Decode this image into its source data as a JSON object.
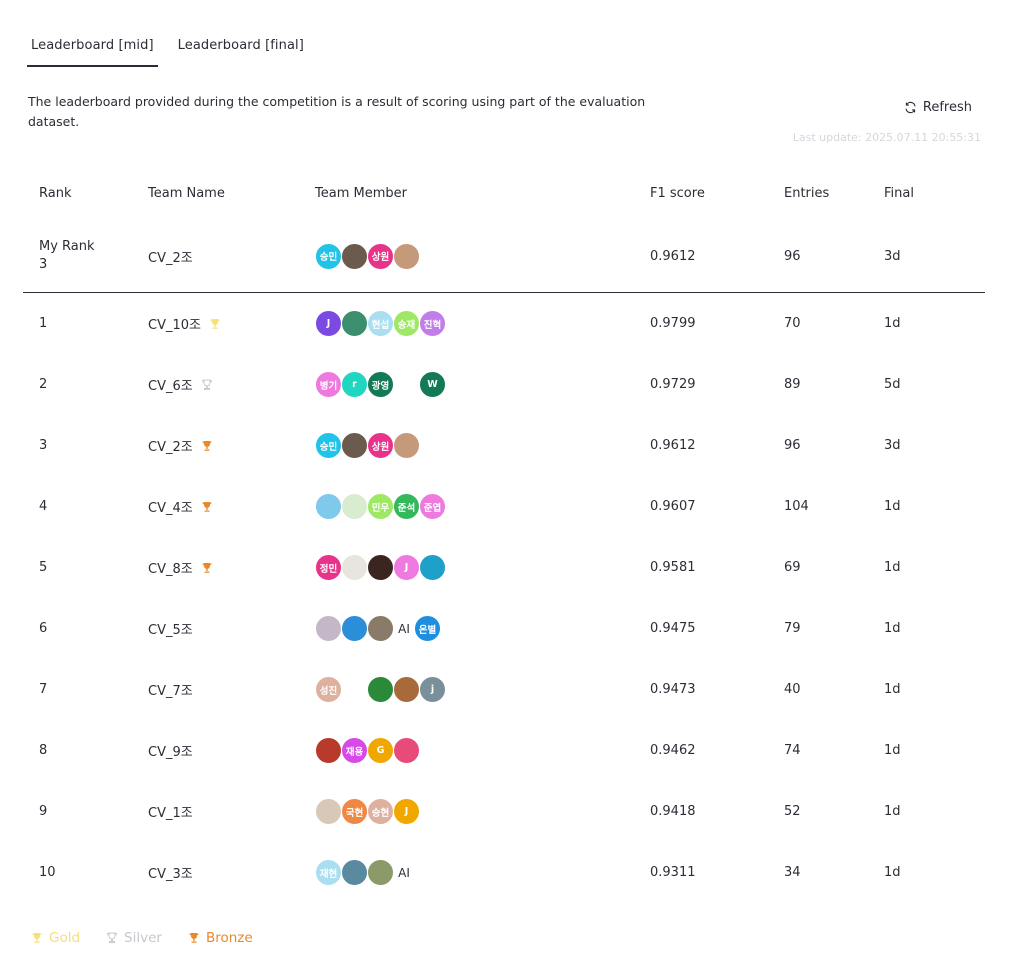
{
  "tabs": [
    {
      "label": "Leaderboard [mid]",
      "active": true
    },
    {
      "label": "Leaderboard [final]",
      "active": false
    }
  ],
  "description": "The leaderboard provided during the competition is a result of scoring using part of the evaluation dataset.",
  "refresh_label": "Refresh",
  "last_update": "Last update: 2025.07.11 20:55:31",
  "columns": {
    "rank": "Rank",
    "team": "Team Name",
    "member": "Team Member",
    "f1": "F1 score",
    "entries": "Entries",
    "final": "Final"
  },
  "my_rank": {
    "label": "My Rank",
    "rank": "3",
    "team": "CV_2조",
    "members": [
      {
        "text": "승민",
        "color": "#22c3e8"
      },
      {
        "text": "",
        "color": "#6b5a4e"
      },
      {
        "text": "상원",
        "color": "#e8338a"
      },
      {
        "text": "",
        "color": "#c49a7a"
      }
    ],
    "f1": "0.9612",
    "entries": "96",
    "final": "3d"
  },
  "rows": [
    {
      "rank": "1",
      "team": "CV_10조",
      "trophy": "gold",
      "f1": "0.9799",
      "entries": "70",
      "final": "1d",
      "members": [
        {
          "text": "J",
          "color": "#7b4ae0"
        },
        {
          "text": "",
          "color": "#3b8f6e"
        },
        {
          "text": "현섭",
          "color": "#a9dff0"
        },
        {
          "text": "승재",
          "color": "#9ee866"
        },
        {
          "text": "진혁",
          "color": "#c27ee8"
        }
      ]
    },
    {
      "rank": "2",
      "team": "CV_6조",
      "trophy": "silver",
      "f1": "0.9729",
      "entries": "89",
      "final": "5d",
      "members": [
        {
          "text": "병기",
          "color": "#ee7ae0"
        },
        {
          "text": "r",
          "color": "#1fd6c0"
        },
        {
          "text": "광영",
          "color": "#127a55"
        },
        {
          "text": "",
          "color": "#ffffff"
        },
        {
          "text": "W",
          "color": "#127a55"
        }
      ]
    },
    {
      "rank": "3",
      "team": "CV_2조",
      "trophy": "bronze",
      "f1": "0.9612",
      "entries": "96",
      "final": "3d",
      "members": [
        {
          "text": "승민",
          "color": "#22c3e8"
        },
        {
          "text": "",
          "color": "#6b5a4e"
        },
        {
          "text": "상원",
          "color": "#e8338a"
        },
        {
          "text": "",
          "color": "#c49a7a"
        }
      ]
    },
    {
      "rank": "4",
      "team": "CV_4조",
      "trophy": "bronze",
      "f1": "0.9607",
      "entries": "104",
      "final": "1d",
      "members": [
        {
          "text": "",
          "color": "#7ec9ec"
        },
        {
          "text": "",
          "color": "#d9ecd0"
        },
        {
          "text": "민우",
          "color": "#9ee866"
        },
        {
          "text": "준석",
          "color": "#34b85c"
        },
        {
          "text": "준엽",
          "color": "#ee7ae0"
        }
      ]
    },
    {
      "rank": "5",
      "team": "CV_8조",
      "trophy": "bronze",
      "f1": "0.9581",
      "entries": "69",
      "final": "1d",
      "members": [
        {
          "text": "정민",
          "color": "#e8338a"
        },
        {
          "text": "",
          "color": "#e8e4de"
        },
        {
          "text": "",
          "color": "#3a2520"
        },
        {
          "text": "J",
          "color": "#ee7ae0"
        },
        {
          "text": "",
          "color": "#1ea0c8"
        }
      ]
    },
    {
      "rank": "6",
      "team": "CV_5조",
      "trophy": "",
      "f1": "0.9475",
      "entries": "79",
      "final": "1d",
      "members": [
        {
          "text": "",
          "color": "#c4b8c8"
        },
        {
          "text": "",
          "color": "#2a8fd8"
        },
        {
          "text": "",
          "color": "#8a7a68"
        },
        {
          "text": "AI",
          "color": "transparent",
          "plain": true
        },
        {
          "text": "온별",
          "color": "#1e8fe0"
        }
      ]
    },
    {
      "rank": "7",
      "team": "CV_7조",
      "trophy": "",
      "f1": "0.9473",
      "entries": "40",
      "final": "1d",
      "members": [
        {
          "text": "성진",
          "color": "#deb0a0"
        },
        {
          "text": "",
          "color": "#ffffff"
        },
        {
          "text": "",
          "color": "#2a8a3a"
        },
        {
          "text": "",
          "color": "#a86a3a"
        },
        {
          "text": "j",
          "color": "#7a8f9a"
        }
      ]
    },
    {
      "rank": "8",
      "team": "CV_9조",
      "trophy": "",
      "f1": "0.9462",
      "entries": "74",
      "final": "1d",
      "members": [
        {
          "text": "",
          "color": "#b83a2a"
        },
        {
          "text": "재용",
          "color": "#d84ae8"
        },
        {
          "text": "G",
          "color": "#f0a800"
        },
        {
          "text": "",
          "color": "#e84a7a"
        }
      ]
    },
    {
      "rank": "9",
      "team": "CV_1조",
      "trophy": "",
      "f1": "0.9418",
      "entries": "52",
      "final": "1d",
      "members": [
        {
          "text": "",
          "color": "#d8c8b8"
        },
        {
          "text": "국현",
          "color": "#ef8844"
        },
        {
          "text": "승현",
          "color": "#deb0a0"
        },
        {
          "text": "J",
          "color": "#f0a800"
        }
      ]
    },
    {
      "rank": "10",
      "team": "CV_3조",
      "trophy": "",
      "f1": "0.9311",
      "entries": "34",
      "final": "1d",
      "members": [
        {
          "text": "재현",
          "color": "#a9dff0"
        },
        {
          "text": "",
          "color": "#5a8aa0"
        },
        {
          "text": "",
          "color": "#8a9a68"
        },
        {
          "text": "AI",
          "color": "transparent",
          "plain": true
        }
      ]
    }
  ],
  "legend": [
    {
      "label": "Gold",
      "color": "#f5e07a"
    },
    {
      "label": "Silver",
      "color": "#c5c8cd"
    },
    {
      "label": "Bronze",
      "color": "#e88a2a"
    }
  ],
  "trophy_colors": {
    "gold": "#f5e07a",
    "silver": "#c5c8cd",
    "bronze": "#e88a2a"
  }
}
